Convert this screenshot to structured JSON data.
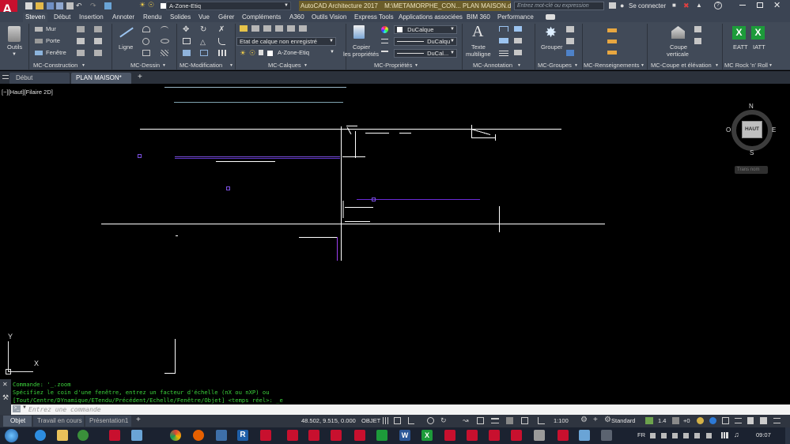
{
  "title_bar": {
    "app_title": "AutoCAD Architecture 2017",
    "file_path": "M:\\METAMORPHE_CON... PLAN MAISON.dwg",
    "search_placeholder": "Entrez mot-clé ou expression",
    "sign_in": "Se connecter",
    "quick_layer": "A-Zone-Etiq"
  },
  "ribbon_tabs": [
    "Steven",
    "Début",
    "Insertion",
    "Annoter",
    "Rendu",
    "Solides",
    "Vue",
    "Gérer",
    "Compléments",
    "A360",
    "Outils Vision",
    "Express Tools",
    "Applications associées",
    "BIM 360",
    "Performance"
  ],
  "ribbon": {
    "outils": "Outils",
    "mur": "Mur",
    "porte": "Porte",
    "fenetre": "Fenêtre",
    "ligne": "Ligne",
    "layer_state": "Etat de calque non enregistré",
    "layer_name": "A-Zone-Etiq",
    "copier": "Copier",
    "les_proprietes": "les propriétés",
    "ducalque_color": "DuCalque",
    "ducalque_linetype": "DuCalqu",
    "ducalque_lineweight": "DuCal...",
    "texte": "Texte",
    "multiligne": "multiligne",
    "grouper": "Grouper",
    "coupe": "Coupe",
    "verticale": "verticale",
    "eatt": "EATT",
    "iatt": "IATT",
    "panels": [
      "MC-Construction",
      "MC-Dessin",
      "MC-Modification",
      "MC-Calques",
      "MC-Propriétés",
      "MC-Annotation",
      "MC-Groupes",
      "MC-Renseignements",
      "MC-Coupe et élévation",
      "MC Rock 'n' Roll"
    ]
  },
  "doc_tabs": [
    "Début",
    "PLAN MAISON*"
  ],
  "viewport": {
    "label": "[−][Haut][Filaire 2D]",
    "viewcube_face": "HAUT",
    "compass": {
      "n": "N",
      "s": "S",
      "e": "E",
      "w": "O"
    },
    "ucs_menu": "Trans nom",
    "ucs_x": "X",
    "ucs_y": "Y"
  },
  "command": {
    "line1": "Commande: '_.zoom",
    "line2": "Spécifiez le coin d'une fenêtre, entrez un facteur d'échelle (nX ou nXP) ou",
    "line3": "[Tout/Centre/DYnamique/ETendu/Précédent/Echelle/Fenêtre/Objet] <temps réel>: _e",
    "placeholder": "Entrez une commande"
  },
  "layout_tabs": [
    "Objet",
    "Travail en cours",
    "Présentation1"
  ],
  "status": {
    "coords": "48.502, 9.515, 0.000",
    "mode": "OBJET",
    "scale": "1:100",
    "workspace": "Standard",
    "value": "1.4",
    "plus": "+0"
  },
  "taskbar": {
    "lang": "FR",
    "time": "09:07"
  },
  "colors": {
    "accent_red": "#c8102e",
    "cmd_green": "#3cd33c",
    "excel_green": "#1d9b3a",
    "purple_lines": "#6a2bd6"
  }
}
